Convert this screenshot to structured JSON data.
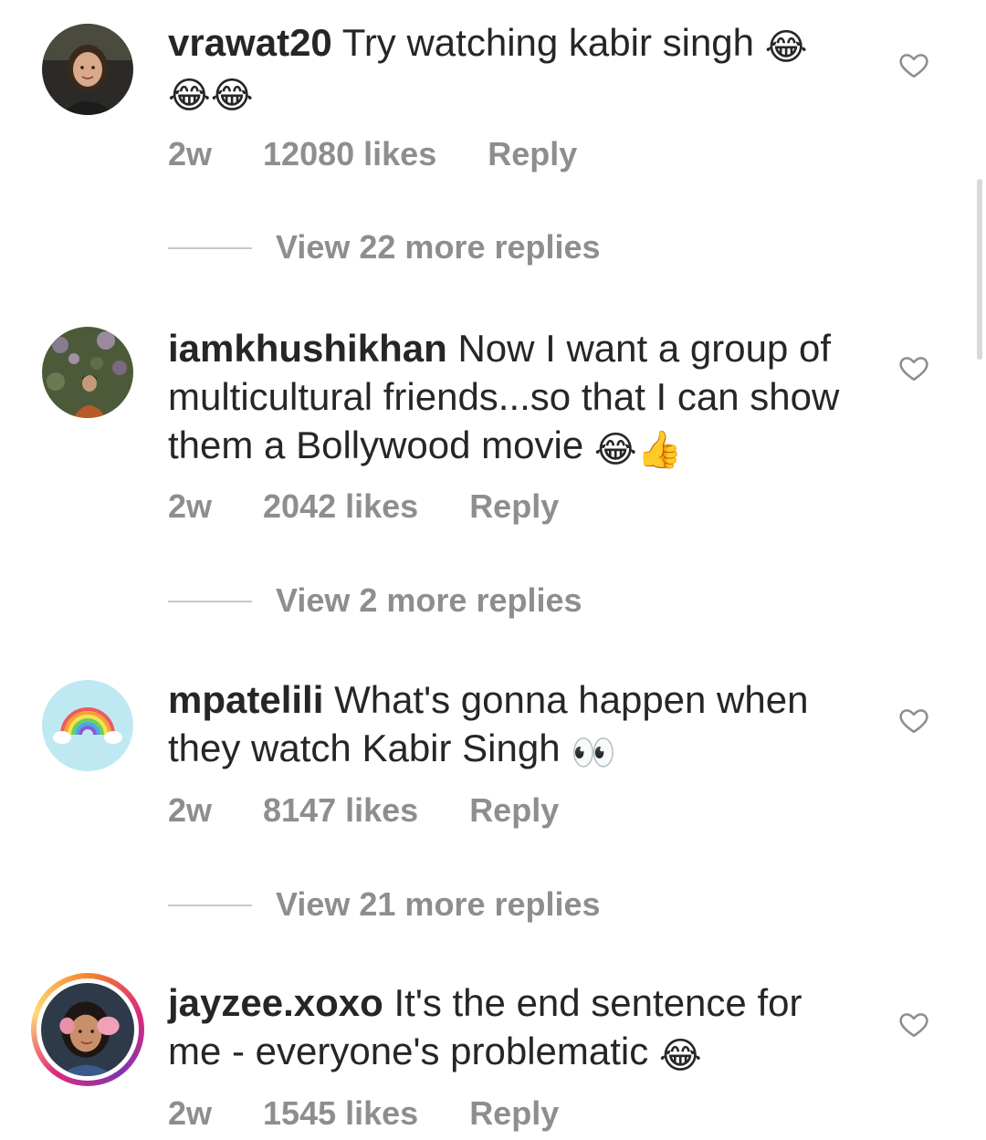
{
  "comments": [
    {
      "username": "vrawat20",
      "text": "Try watching kabir singh",
      "emoji": "😂",
      "emoji_line2": "😂😂",
      "time": "2w",
      "likes": "12080 likes",
      "reply": "Reply",
      "view_replies": "View 22 more replies"
    },
    {
      "username": "iamkhushikhan",
      "text": "Now I want a group of multicultural friends...so that I can show them a Bollywood movie",
      "emoji": "😂👍",
      "time": "2w",
      "likes": "2042 likes",
      "reply": "Reply",
      "view_replies": "View 2 more replies"
    },
    {
      "username": "mpatelili",
      "text": "What's gonna happen when they watch Kabir Singh",
      "emoji": "👀",
      "time": "2w",
      "likes": "8147 likes",
      "reply": "Reply",
      "view_replies": "View 21 more replies"
    },
    {
      "username": "jayzee.xoxo",
      "text": "It's the end sentence for me - everyone's problematic",
      "emoji": "😂",
      "time": "2w",
      "likes": "1545 likes",
      "reply": "Reply"
    }
  ],
  "icons": {
    "like": "heart-outline-icon",
    "avatar_story_ring": "gradient-ring"
  },
  "colors": {
    "text": "#262626",
    "secondary": "#8e8e8e",
    "divider": "#c7c7c7"
  }
}
